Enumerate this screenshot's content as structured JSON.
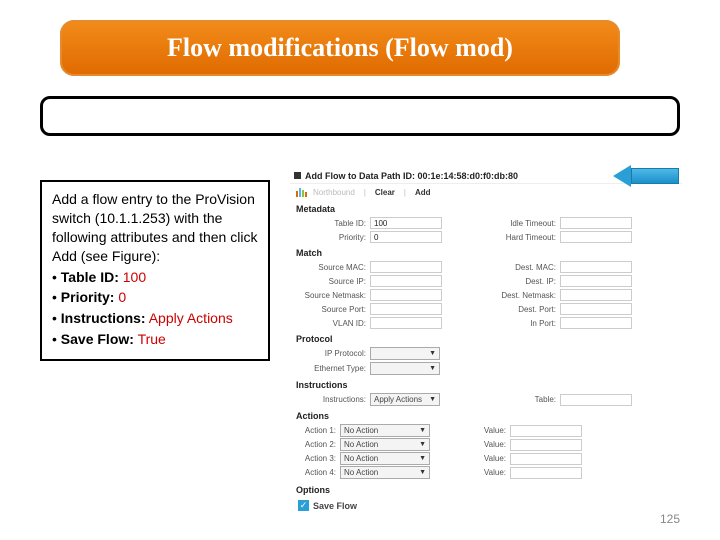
{
  "title": "Flow modifications (Flow mod)",
  "instructions": {
    "intro": "Add a flow entry to the ProVision switch (10.1.1.253) with the following attributes and then click Add (see Figure):",
    "items": [
      {
        "label": "Table ID:",
        "value": "100"
      },
      {
        "label": "Priority:",
        "value": "0"
      },
      {
        "label": "Instructions:",
        "value": "Apply Actions"
      },
      {
        "label": "Save Flow:",
        "value": "True"
      }
    ]
  },
  "form": {
    "header_title": "Add Flow to Data Path ID: 00:1e:14:58:d0:f0:db:80",
    "brand": "Northbound",
    "btn_clear": "Clear",
    "btn_add": "Add",
    "metadata": {
      "heading": "Metadata",
      "table_id_label": "Table ID:",
      "table_id_value": "100",
      "priority_label": "Priority:",
      "priority_value": "0",
      "idle_label": "Idle Timeout:",
      "idle_value": "",
      "hard_label": "Hard Timeout:",
      "hard_value": ""
    },
    "match": {
      "heading": "Match",
      "left": [
        {
          "label": "Source MAC:"
        },
        {
          "label": "Source IP:"
        },
        {
          "label": "Source Netmask:"
        },
        {
          "label": "Source Port:"
        },
        {
          "label": "VLAN ID:"
        }
      ],
      "right": [
        {
          "label": "Dest. MAC:"
        },
        {
          "label": "Dest. IP:"
        },
        {
          "label": "Dest. Netmask:"
        },
        {
          "label": "Dest. Port:"
        },
        {
          "label": "In Port:"
        }
      ]
    },
    "protocol": {
      "heading": "Protocol",
      "ip_label": "IP Protocol:",
      "ip_value": "",
      "eth_label": "Ethernet Type:",
      "eth_value": ""
    },
    "instructions_sec": {
      "heading": "Instructions",
      "instr_label": "Instructions:",
      "instr_value": "Apply Actions",
      "table_label": "Table:",
      "table_value": ""
    },
    "actions": {
      "heading": "Actions",
      "rows": [
        {
          "label": "Action 1:",
          "value": "No Action",
          "vlabel": "Value:"
        },
        {
          "label": "Action 2:",
          "value": "No Action",
          "vlabel": "Value:"
        },
        {
          "label": "Action 3:",
          "value": "No Action",
          "vlabel": "Value:"
        },
        {
          "label": "Action 4:",
          "value": "No Action",
          "vlabel": "Value:"
        }
      ]
    },
    "options": {
      "heading": "Options",
      "save_flow_label": "Save Flow",
      "save_flow_checked": true
    }
  },
  "page_number": "125"
}
